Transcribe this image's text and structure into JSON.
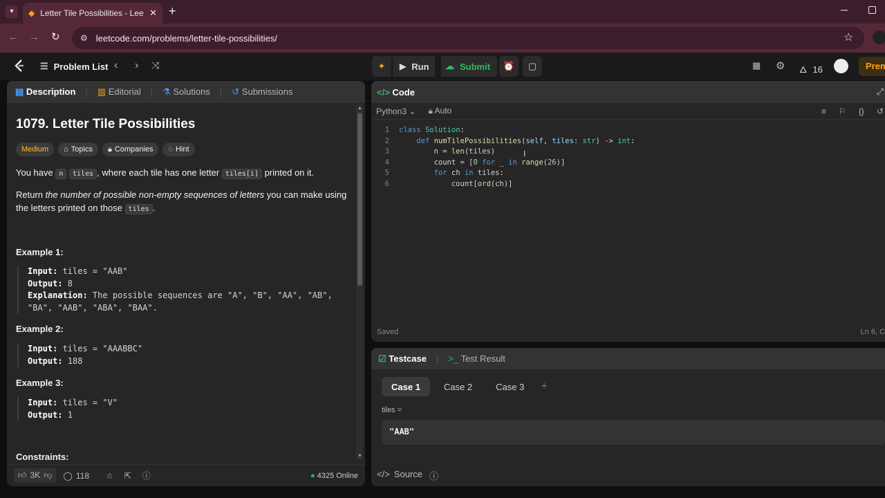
{
  "browser": {
    "tab_title": "Letter Tile Possibilities - LeetCode",
    "url": "leetcode.com/problems/letter-tile-possibilities/"
  },
  "header": {
    "problem_list": "Problem List",
    "run": "Run",
    "submit": "Submit",
    "streak": "16",
    "premium": "Prem"
  },
  "left": {
    "tabs": [
      "Description",
      "Editorial",
      "Solutions",
      "Submissions"
    ],
    "title": "1079. Letter Tile Possibilities",
    "difficulty": "Medium",
    "topics": "Topics",
    "companies": "Companies",
    "hint": "Hint",
    "p1": {
      "a": "You have ",
      "n": "n",
      "b": " ",
      "tiles": "tiles",
      "c": ", where each tile has one letter ",
      "tilesi": "tiles[i]",
      "d": " printed on it."
    },
    "p2": {
      "a": "Return ",
      "em": "the number of possible non-empty sequences of letters",
      "b": " you can make using the letters printed on those ",
      "tiles": "tiles",
      "c": "."
    },
    "examples": [
      {
        "title": "Example 1:",
        "input_label": "Input:",
        "input": " tiles = \"AAB\"",
        "output_label": "Output:",
        "output": " 8",
        "expl_label": "Explanation:",
        "expl": " The possible sequences are \"A\", \"B\", \"AA\", \"AB\", \"BA\", \"AAB\", \"ABA\", \"BAA\"."
      },
      {
        "title": "Example 2:",
        "input_label": "Input:",
        "input": " tiles = \"AAABBC\"",
        "output_label": "Output:",
        "output": " 188"
      },
      {
        "title": "Example 3:",
        "input_label": "Input:",
        "input": " tiles = \"V\"",
        "output_label": "Output:",
        "output": " 1"
      }
    ],
    "constraints": "Constraints:",
    "likes": "3K",
    "comments": "118",
    "online": "4325 Online"
  },
  "editor": {
    "title": "Code",
    "language": "Python3",
    "auto": "Auto",
    "status": "Saved",
    "position": "Ln 6, C",
    "lines": [
      [
        [
          "kw",
          "class "
        ],
        [
          "cl",
          "Solution"
        ],
        [
          "tx",
          ":"
        ]
      ],
      [
        [
          "tx",
          "    "
        ],
        [
          "kw",
          "def "
        ],
        [
          "fn",
          "numTilePossibilities"
        ],
        [
          "tx",
          "("
        ],
        [
          "vr",
          "self"
        ],
        [
          "tx",
          ", "
        ],
        [
          "vr",
          "tiles"
        ],
        [
          "tx",
          ": "
        ],
        [
          "cl",
          "str"
        ],
        [
          "tx",
          ") -> "
        ],
        [
          "cl",
          "int"
        ],
        [
          "tx",
          ":"
        ]
      ],
      [
        [
          "tx",
          "        n = "
        ],
        [
          "fn",
          "len"
        ],
        [
          "tx",
          "(tiles)"
        ]
      ],
      [
        [
          "tx",
          "        count = ["
        ],
        [
          "nm",
          "0"
        ],
        [
          "tx",
          " "
        ],
        [
          "kw",
          "for"
        ],
        [
          "tx",
          " _ "
        ],
        [
          "kw",
          "in"
        ],
        [
          "tx",
          " "
        ],
        [
          "fn",
          "range"
        ],
        [
          "tx",
          "("
        ],
        [
          "nm",
          "26"
        ],
        [
          "tx",
          ")]"
        ]
      ],
      [
        [
          "tx",
          "        "
        ],
        [
          "kw",
          "for"
        ],
        [
          "tx",
          " ch "
        ],
        [
          "kw",
          "in"
        ],
        [
          "tx",
          " tiles:"
        ]
      ],
      [
        [
          "tx",
          "            count["
        ],
        [
          "fn",
          "ord"
        ],
        [
          "tx",
          "(ch)]"
        ]
      ]
    ]
  },
  "testcase": {
    "tab": "Testcase",
    "result_tab": "Test Result",
    "cases": [
      "Case 1",
      "Case 2",
      "Case 3"
    ],
    "plus": "+",
    "var_label": "tiles =",
    "var_value": "\"AAB\"",
    "source": "Source"
  },
  "colors": {
    "accent": "#ffa116",
    "green": "#2cbb5d",
    "medium": "#ffc01e"
  }
}
